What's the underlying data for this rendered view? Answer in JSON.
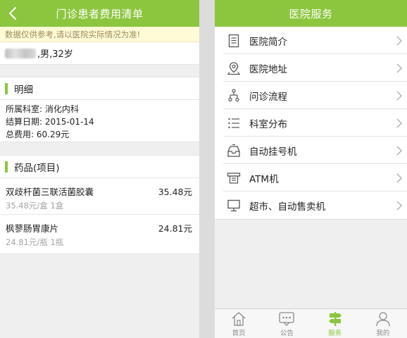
{
  "colors": {
    "accent": "#8cc63f",
    "notice_bg": "#fffbd6",
    "muted": "#a5a5a5"
  },
  "left": {
    "title": "门诊患者费用清单",
    "notice": "数据仅供参考,请以医院实际情况为准!",
    "patient_info": ",男,32岁",
    "detail": {
      "heading": "明细",
      "department": "所属科室: 消化内科",
      "settle_date": "结算日期: 2015-01-14",
      "total": "总费用: 60.29元"
    },
    "drugs": {
      "heading": "药品(项目)",
      "items": [
        {
          "name": "双歧杆菌三联活菌胶囊",
          "price": "35.48元",
          "unit": "35.48元/盒 1盒"
        },
        {
          "name": "枫蓼肠胃康片",
          "price": "24.81元",
          "unit": "24.81元/瓶 1瓶"
        }
      ]
    }
  },
  "right": {
    "title": "医院服务",
    "menu": [
      {
        "label": "医院简介",
        "icon": "document-icon"
      },
      {
        "label": "医院地址",
        "icon": "location-pin-icon"
      },
      {
        "label": "问诊流程",
        "icon": "flow-icon"
      },
      {
        "label": "科室分布",
        "icon": "list-icon"
      },
      {
        "label": "自动挂号机",
        "icon": "inbox-tray-icon"
      },
      {
        "label": "ATM机",
        "icon": "atm-icon"
      },
      {
        "label": "超市、自动售卖机",
        "icon": "monitor-icon"
      }
    ],
    "tabs": [
      {
        "label": "首页",
        "icon": "home-icon"
      },
      {
        "label": "公告",
        "icon": "chat-bubble-icon"
      },
      {
        "label": "服务",
        "icon": "signpost-icon",
        "active": true
      },
      {
        "label": "我的",
        "icon": "person-icon"
      }
    ]
  }
}
